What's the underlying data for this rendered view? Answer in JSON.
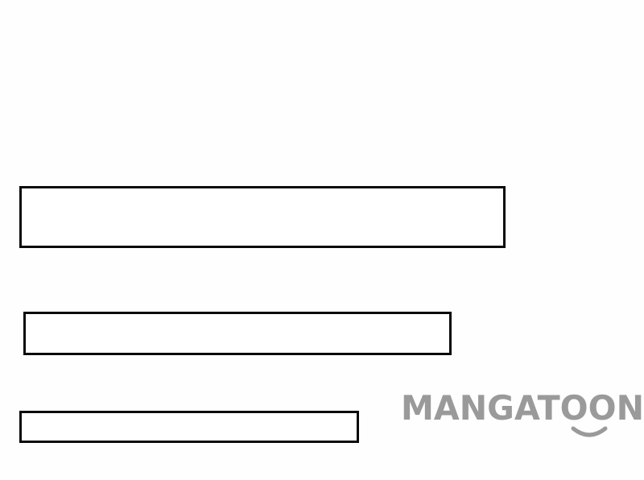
{
  "panel": {
    "boxes": [
      {
        "text": ""
      },
      {
        "text": ""
      },
      {
        "text": ""
      }
    ]
  },
  "watermark": {
    "text": "MANGATOON",
    "color": "#9a9a9a",
    "smile_icon": "smile-icon"
  }
}
